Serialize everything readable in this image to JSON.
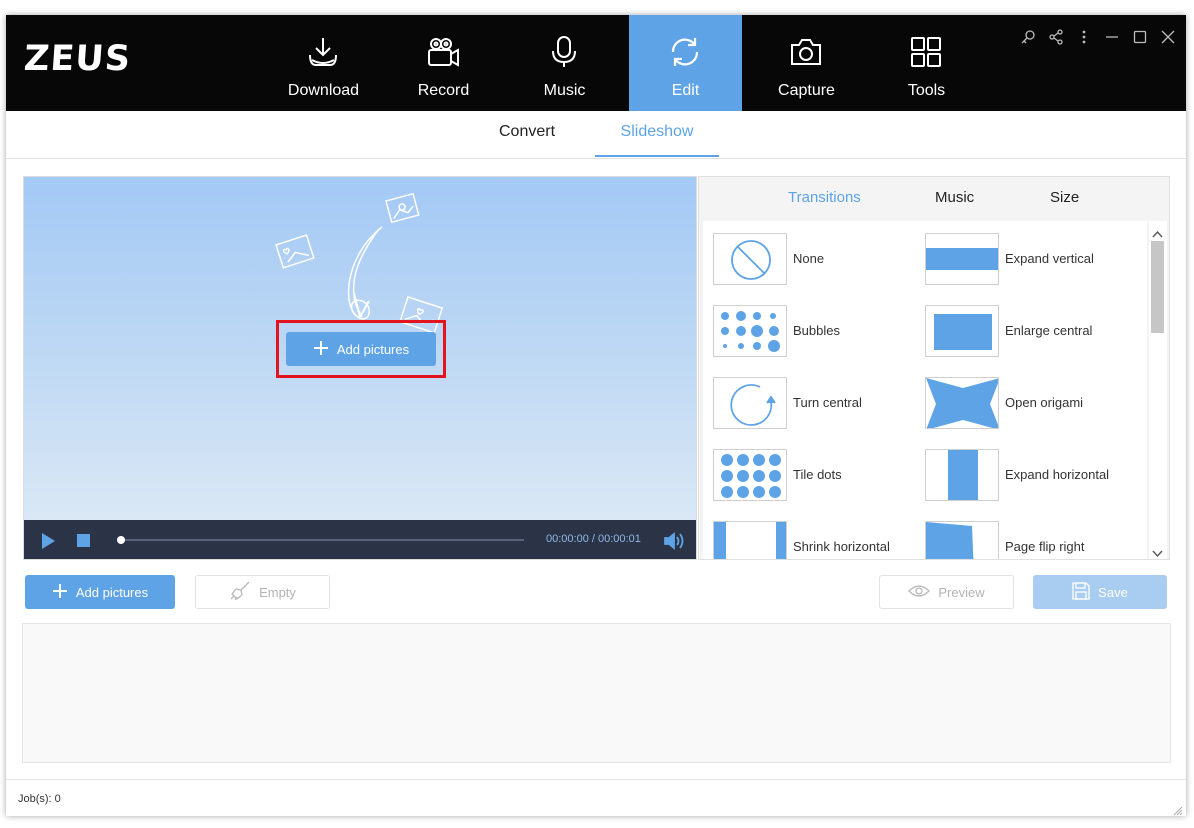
{
  "app": {
    "logo": "ZEUS"
  },
  "nav": {
    "items": [
      {
        "label": "Download",
        "icon": "download-icon"
      },
      {
        "label": "Record",
        "icon": "video-camera-icon"
      },
      {
        "label": "Music",
        "icon": "microphone-icon"
      },
      {
        "label": "Edit",
        "icon": "refresh-icon",
        "active": true
      },
      {
        "label": "Capture",
        "icon": "camera-icon"
      },
      {
        "label": "Tools",
        "icon": "grid-tools-icon"
      }
    ]
  },
  "window_controls": [
    "search-key-icon",
    "share-icon",
    "more-icon",
    "minimize-icon",
    "maximize-icon",
    "close-icon"
  ],
  "subtabs": {
    "convert": "Convert",
    "slideshow": "Slideshow",
    "active": "Slideshow"
  },
  "preview": {
    "add_button": "Add pictures",
    "time": "00:00:00 / 00:00:01",
    "progress": 0
  },
  "panel": {
    "tabs": {
      "transitions": "Transitions",
      "music": "Music",
      "size": "Size",
      "active": "Transitions"
    },
    "transitions": [
      {
        "label": "None"
      },
      {
        "label": "Expand vertical"
      },
      {
        "label": "Bubbles"
      },
      {
        "label": "Enlarge central"
      },
      {
        "label": "Turn central"
      },
      {
        "label": "Open origami"
      },
      {
        "label": "Tile dots"
      },
      {
        "label": "Expand horizontal"
      },
      {
        "label": "Shrink horizontal"
      },
      {
        "label": "Page flip right"
      }
    ]
  },
  "toolbar": {
    "add_pictures": "Add pictures",
    "empty": "Empty",
    "preview": "Preview",
    "save": "Save"
  },
  "status": {
    "jobs": "Job(s): 0"
  },
  "colors": {
    "accent": "#5ea3e6",
    "header": "#070707",
    "highlight": "#e3141b",
    "player": "#2b3447"
  }
}
